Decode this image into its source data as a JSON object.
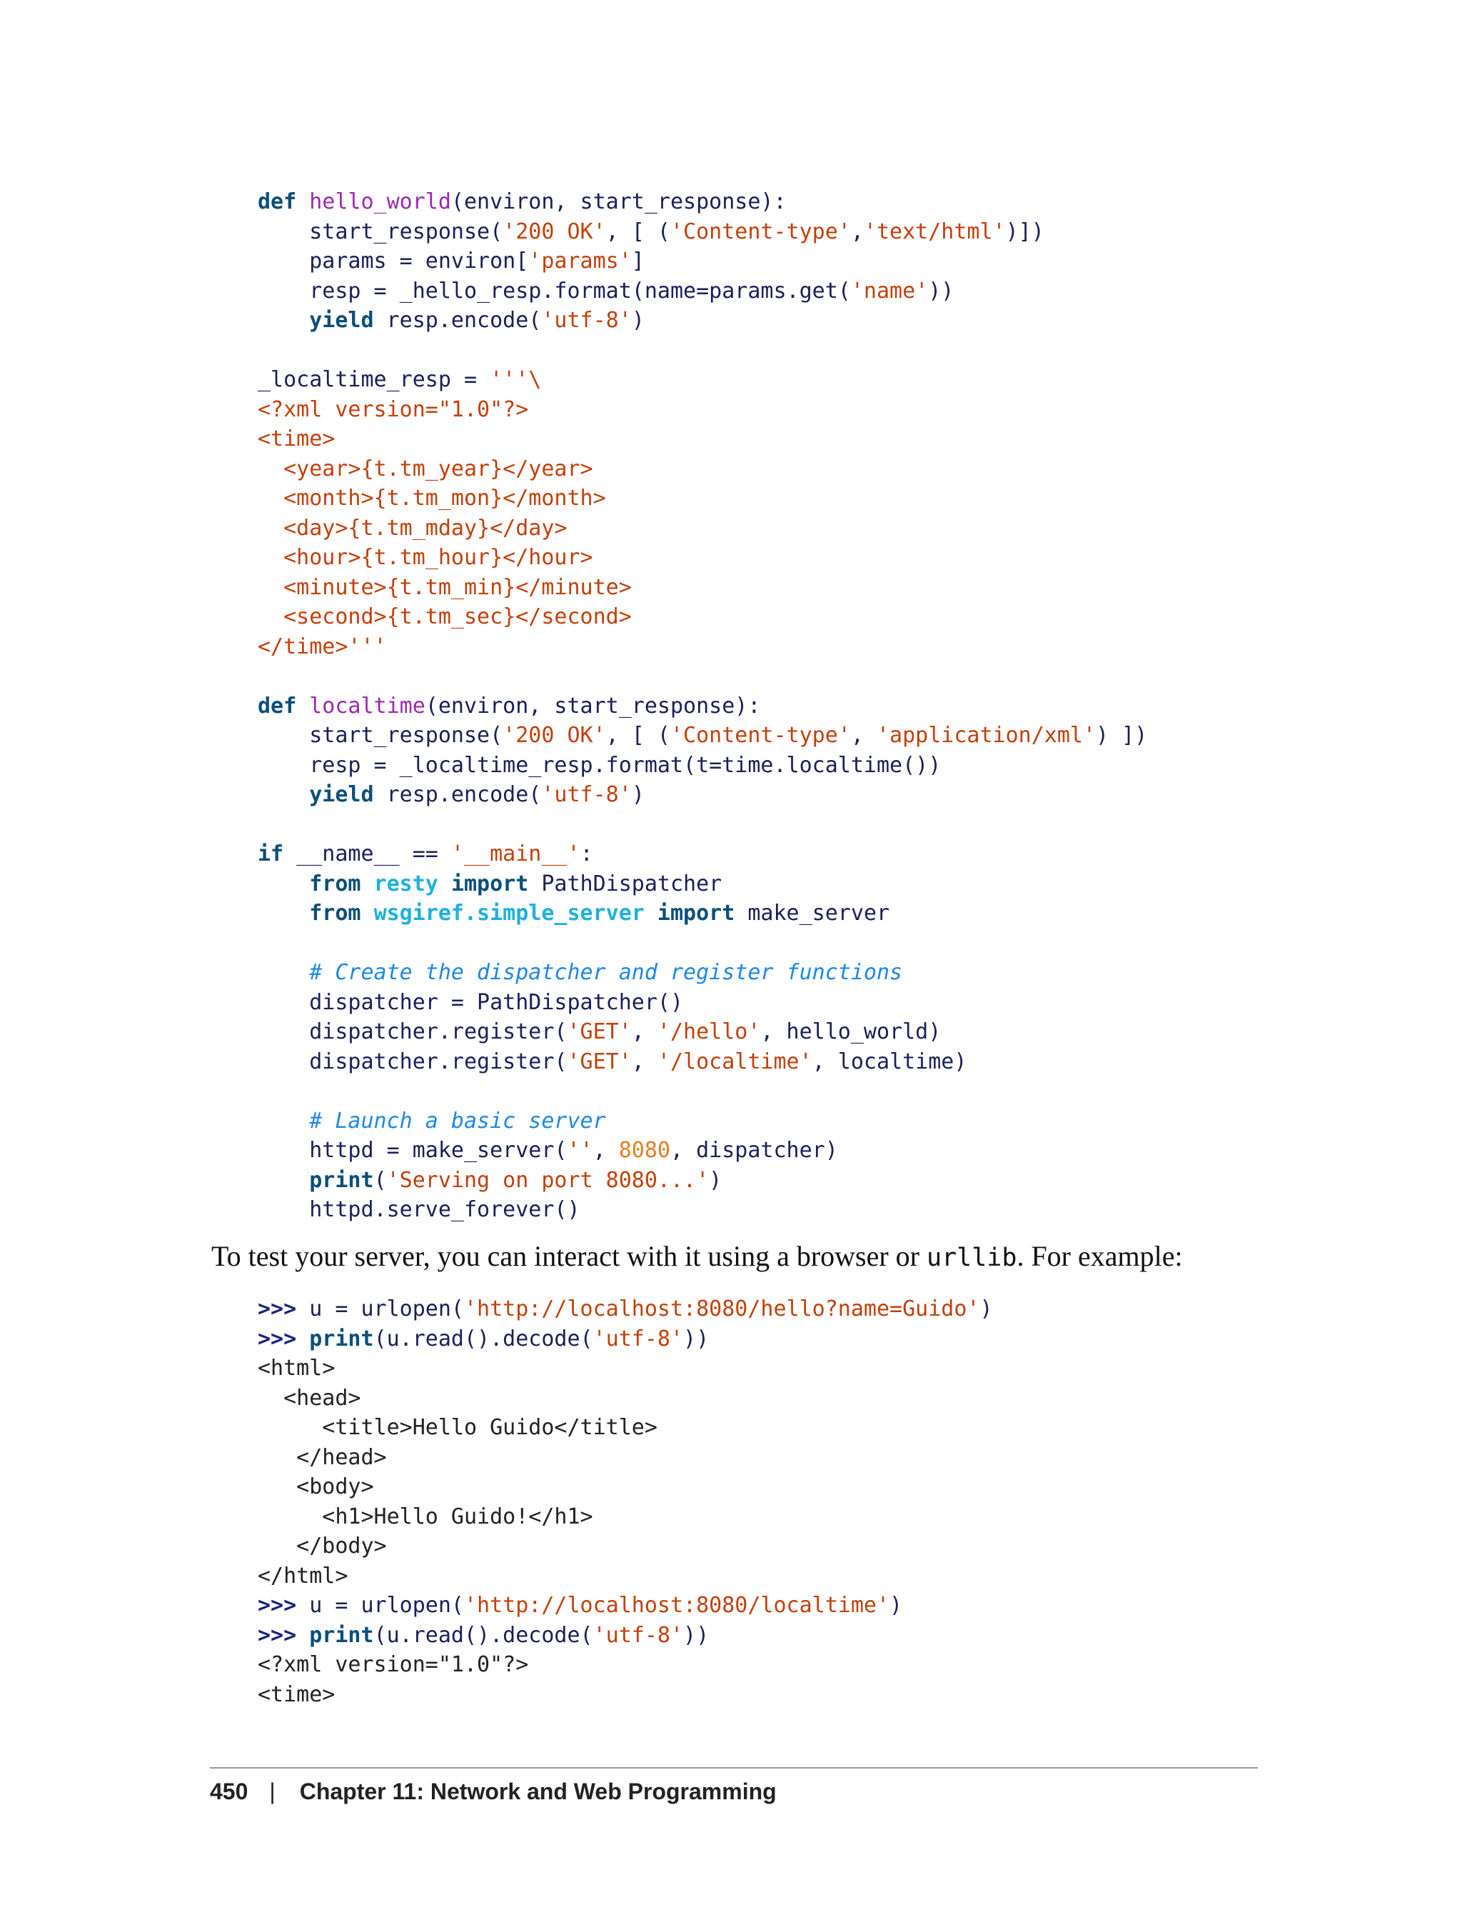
{
  "code_block_1": [
    [
      [
        "k",
        "def"
      ],
      [
        "t",
        " "
      ],
      [
        "f",
        "hello_world"
      ],
      [
        "",
        "(environ, start_response):"
      ]
    ],
    [
      [
        "",
        "    start_response("
      ],
      [
        "s",
        "'200 OK'"
      ],
      [
        "",
        ", [ ("
      ],
      [
        "s",
        "'Content-type'"
      ],
      [
        "",
        ","
      ],
      [
        "s",
        "'text/html'"
      ],
      [
        "",
        ")])"
      ]
    ],
    [
      [
        "",
        "    params = environ["
      ],
      [
        "s",
        "'params'"
      ],
      [
        "",
        "]"
      ]
    ],
    [
      [
        "",
        "    resp = _hello_resp.format(name=params.get("
      ],
      [
        "s",
        "'name'"
      ],
      [
        "",
        "))"
      ]
    ],
    [
      [
        "k",
        "    yield"
      ],
      [
        "",
        " resp.encode("
      ],
      [
        "s",
        "'utf-8'"
      ],
      [
        "",
        ")"
      ]
    ],
    [
      [
        "",
        ""
      ]
    ],
    [
      [
        "",
        "_localtime_resp = "
      ],
      [
        "s",
        "'''\\"
      ]
    ],
    [
      [
        "s",
        "<?xml version=\"1.0\"?>"
      ]
    ],
    [
      [
        "s",
        "<time>"
      ]
    ],
    [
      [
        "s",
        "  <year>{t.tm_year}</year>"
      ]
    ],
    [
      [
        "s",
        "  <month>{t.tm_mon}</month>"
      ]
    ],
    [
      [
        "s",
        "  <day>{t.tm_mday}</day>"
      ]
    ],
    [
      [
        "s",
        "  <hour>{t.tm_hour}</hour>"
      ]
    ],
    [
      [
        "s",
        "  <minute>{t.tm_min}</minute>"
      ]
    ],
    [
      [
        "s",
        "  <second>{t.tm_sec}</second>"
      ]
    ],
    [
      [
        "s",
        "</time>'''"
      ]
    ],
    [
      [
        "",
        ""
      ]
    ],
    [
      [
        "k",
        "def"
      ],
      [
        "t",
        " "
      ],
      [
        "f",
        "localtime"
      ],
      [
        "",
        "(environ, start_response):"
      ]
    ],
    [
      [
        "",
        "    start_response("
      ],
      [
        "s",
        "'200 OK'"
      ],
      [
        "",
        ", [ ("
      ],
      [
        "s",
        "'Content-type'"
      ],
      [
        "",
        ", "
      ],
      [
        "s",
        "'application/xml'"
      ],
      [
        "",
        ") ])"
      ]
    ],
    [
      [
        "",
        "    resp = _localtime_resp.format(t=time.localtime())"
      ]
    ],
    [
      [
        "k",
        "    yield"
      ],
      [
        "",
        " resp.encode("
      ],
      [
        "s",
        "'utf-8'"
      ],
      [
        "",
        ")"
      ]
    ],
    [
      [
        "",
        ""
      ]
    ],
    [
      [
        "k",
        "if"
      ],
      [
        "",
        " __name__ == "
      ],
      [
        "s",
        "'__main__'"
      ],
      [
        "",
        ":"
      ]
    ],
    [
      [
        "k",
        "    from"
      ],
      [
        "t",
        " "
      ],
      [
        "m",
        "resty"
      ],
      [
        "t",
        " "
      ],
      [
        "k",
        "import"
      ],
      [
        "",
        " PathDispatcher"
      ]
    ],
    [
      [
        "k",
        "    from"
      ],
      [
        "t",
        " "
      ],
      [
        "m",
        "wsgiref.simple_server"
      ],
      [
        "t",
        " "
      ],
      [
        "k",
        "import"
      ],
      [
        "",
        " make_server"
      ]
    ],
    [
      [
        "",
        ""
      ]
    ],
    [
      [
        "c",
        "    # Create the dispatcher and register functions"
      ]
    ],
    [
      [
        "",
        "    dispatcher = PathDispatcher()"
      ]
    ],
    [
      [
        "",
        "    dispatcher.register("
      ],
      [
        "s",
        "'GET'"
      ],
      [
        "",
        ", "
      ],
      [
        "s",
        "'/hello'"
      ],
      [
        "",
        ", hello_world)"
      ]
    ],
    [
      [
        "",
        "    dispatcher.register("
      ],
      [
        "s",
        "'GET'"
      ],
      [
        "",
        ", "
      ],
      [
        "s",
        "'/localtime'"
      ],
      [
        "",
        ", localtime)"
      ]
    ],
    [
      [
        "",
        ""
      ]
    ],
    [
      [
        "c",
        "    # Launch a basic server"
      ]
    ],
    [
      [
        "",
        "    httpd = make_server("
      ],
      [
        "s",
        "''"
      ],
      [
        "",
        ", "
      ],
      [
        "n",
        "8080"
      ],
      [
        "",
        ", dispatcher)"
      ]
    ],
    [
      [
        "k",
        "    print"
      ],
      [
        "",
        "("
      ],
      [
        "s",
        "'Serving on port 8080...'"
      ],
      [
        "",
        ")"
      ]
    ],
    [
      [
        "",
        "    httpd.serve_forever()"
      ]
    ]
  ],
  "prose": {
    "before": "To test your server, you can interact with it using a browser or ",
    "code": "urllib",
    "after": ". For example:"
  },
  "code_block_2": [
    [
      [
        "p",
        ">>>"
      ],
      [
        "",
        " u = urlopen("
      ],
      [
        "s",
        "'http://localhost:8080/hello?name=Guido'"
      ],
      [
        "",
        ")"
      ]
    ],
    [
      [
        "p",
        ">>>"
      ],
      [
        "t",
        " "
      ],
      [
        "k",
        "print"
      ],
      [
        "",
        "(u.read().decode("
      ],
      [
        "s",
        "'utf-8'"
      ],
      [
        "",
        "))"
      ]
    ],
    [
      [
        "t",
        "<html>"
      ]
    ],
    [
      [
        "t",
        "  <head>"
      ]
    ],
    [
      [
        "t",
        "     <title>Hello Guido</title>"
      ]
    ],
    [
      [
        "t",
        "   </head>"
      ]
    ],
    [
      [
        "t",
        "   <body>"
      ]
    ],
    [
      [
        "t",
        "     <h1>Hello Guido!</h1>"
      ]
    ],
    [
      [
        "t",
        "   </body>"
      ]
    ],
    [
      [
        "t",
        "</html>"
      ]
    ],
    [
      [
        "p",
        ">>>"
      ],
      [
        "",
        " u = urlopen("
      ],
      [
        "s",
        "'http://localhost:8080/localtime'"
      ],
      [
        "",
        ")"
      ]
    ],
    [
      [
        "p",
        ">>>"
      ],
      [
        "t",
        " "
      ],
      [
        "k",
        "print"
      ],
      [
        "",
        "(u.read().decode("
      ],
      [
        "s",
        "'utf-8'"
      ],
      [
        "",
        "))"
      ]
    ],
    [
      [
        "t",
        "<?xml version=\"1.0\"?>"
      ]
    ],
    [
      [
        "t",
        "<time>"
      ]
    ]
  ],
  "footer": {
    "page_number": "450",
    "separator": "|",
    "chapter": "Chapter 11: Network and Web Programming"
  }
}
